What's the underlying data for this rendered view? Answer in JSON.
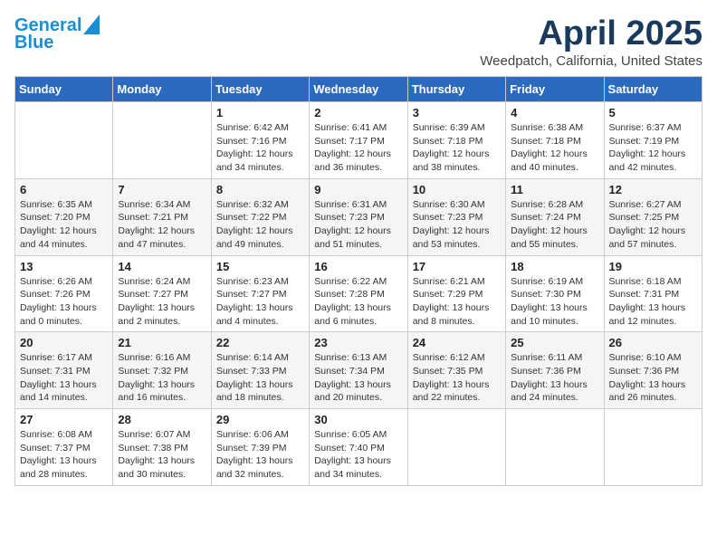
{
  "logo": {
    "line1": "General",
    "line2": "Blue"
  },
  "title": "April 2025",
  "location": "Weedpatch, California, United States",
  "weekdays": [
    "Sunday",
    "Monday",
    "Tuesday",
    "Wednesday",
    "Thursday",
    "Friday",
    "Saturday"
  ],
  "weeks": [
    [
      {
        "day": "",
        "info": ""
      },
      {
        "day": "",
        "info": ""
      },
      {
        "day": "1",
        "info": "Sunrise: 6:42 AM\nSunset: 7:16 PM\nDaylight: 12 hours and 34 minutes."
      },
      {
        "day": "2",
        "info": "Sunrise: 6:41 AM\nSunset: 7:17 PM\nDaylight: 12 hours and 36 minutes."
      },
      {
        "day": "3",
        "info": "Sunrise: 6:39 AM\nSunset: 7:18 PM\nDaylight: 12 hours and 38 minutes."
      },
      {
        "day": "4",
        "info": "Sunrise: 6:38 AM\nSunset: 7:18 PM\nDaylight: 12 hours and 40 minutes."
      },
      {
        "day": "5",
        "info": "Sunrise: 6:37 AM\nSunset: 7:19 PM\nDaylight: 12 hours and 42 minutes."
      }
    ],
    [
      {
        "day": "6",
        "info": "Sunrise: 6:35 AM\nSunset: 7:20 PM\nDaylight: 12 hours and 44 minutes."
      },
      {
        "day": "7",
        "info": "Sunrise: 6:34 AM\nSunset: 7:21 PM\nDaylight: 12 hours and 47 minutes."
      },
      {
        "day": "8",
        "info": "Sunrise: 6:32 AM\nSunset: 7:22 PM\nDaylight: 12 hours and 49 minutes."
      },
      {
        "day": "9",
        "info": "Sunrise: 6:31 AM\nSunset: 7:23 PM\nDaylight: 12 hours and 51 minutes."
      },
      {
        "day": "10",
        "info": "Sunrise: 6:30 AM\nSunset: 7:23 PM\nDaylight: 12 hours and 53 minutes."
      },
      {
        "day": "11",
        "info": "Sunrise: 6:28 AM\nSunset: 7:24 PM\nDaylight: 12 hours and 55 minutes."
      },
      {
        "day": "12",
        "info": "Sunrise: 6:27 AM\nSunset: 7:25 PM\nDaylight: 12 hours and 57 minutes."
      }
    ],
    [
      {
        "day": "13",
        "info": "Sunrise: 6:26 AM\nSunset: 7:26 PM\nDaylight: 13 hours and 0 minutes."
      },
      {
        "day": "14",
        "info": "Sunrise: 6:24 AM\nSunset: 7:27 PM\nDaylight: 13 hours and 2 minutes."
      },
      {
        "day": "15",
        "info": "Sunrise: 6:23 AM\nSunset: 7:27 PM\nDaylight: 13 hours and 4 minutes."
      },
      {
        "day": "16",
        "info": "Sunrise: 6:22 AM\nSunset: 7:28 PM\nDaylight: 13 hours and 6 minutes."
      },
      {
        "day": "17",
        "info": "Sunrise: 6:21 AM\nSunset: 7:29 PM\nDaylight: 13 hours and 8 minutes."
      },
      {
        "day": "18",
        "info": "Sunrise: 6:19 AM\nSunset: 7:30 PM\nDaylight: 13 hours and 10 minutes."
      },
      {
        "day": "19",
        "info": "Sunrise: 6:18 AM\nSunset: 7:31 PM\nDaylight: 13 hours and 12 minutes."
      }
    ],
    [
      {
        "day": "20",
        "info": "Sunrise: 6:17 AM\nSunset: 7:31 PM\nDaylight: 13 hours and 14 minutes."
      },
      {
        "day": "21",
        "info": "Sunrise: 6:16 AM\nSunset: 7:32 PM\nDaylight: 13 hours and 16 minutes."
      },
      {
        "day": "22",
        "info": "Sunrise: 6:14 AM\nSunset: 7:33 PM\nDaylight: 13 hours and 18 minutes."
      },
      {
        "day": "23",
        "info": "Sunrise: 6:13 AM\nSunset: 7:34 PM\nDaylight: 13 hours and 20 minutes."
      },
      {
        "day": "24",
        "info": "Sunrise: 6:12 AM\nSunset: 7:35 PM\nDaylight: 13 hours and 22 minutes."
      },
      {
        "day": "25",
        "info": "Sunrise: 6:11 AM\nSunset: 7:36 PM\nDaylight: 13 hours and 24 minutes."
      },
      {
        "day": "26",
        "info": "Sunrise: 6:10 AM\nSunset: 7:36 PM\nDaylight: 13 hours and 26 minutes."
      }
    ],
    [
      {
        "day": "27",
        "info": "Sunrise: 6:08 AM\nSunset: 7:37 PM\nDaylight: 13 hours and 28 minutes."
      },
      {
        "day": "28",
        "info": "Sunrise: 6:07 AM\nSunset: 7:38 PM\nDaylight: 13 hours and 30 minutes."
      },
      {
        "day": "29",
        "info": "Sunrise: 6:06 AM\nSunset: 7:39 PM\nDaylight: 13 hours and 32 minutes."
      },
      {
        "day": "30",
        "info": "Sunrise: 6:05 AM\nSunset: 7:40 PM\nDaylight: 13 hours and 34 minutes."
      },
      {
        "day": "",
        "info": ""
      },
      {
        "day": "",
        "info": ""
      },
      {
        "day": "",
        "info": ""
      }
    ]
  ]
}
